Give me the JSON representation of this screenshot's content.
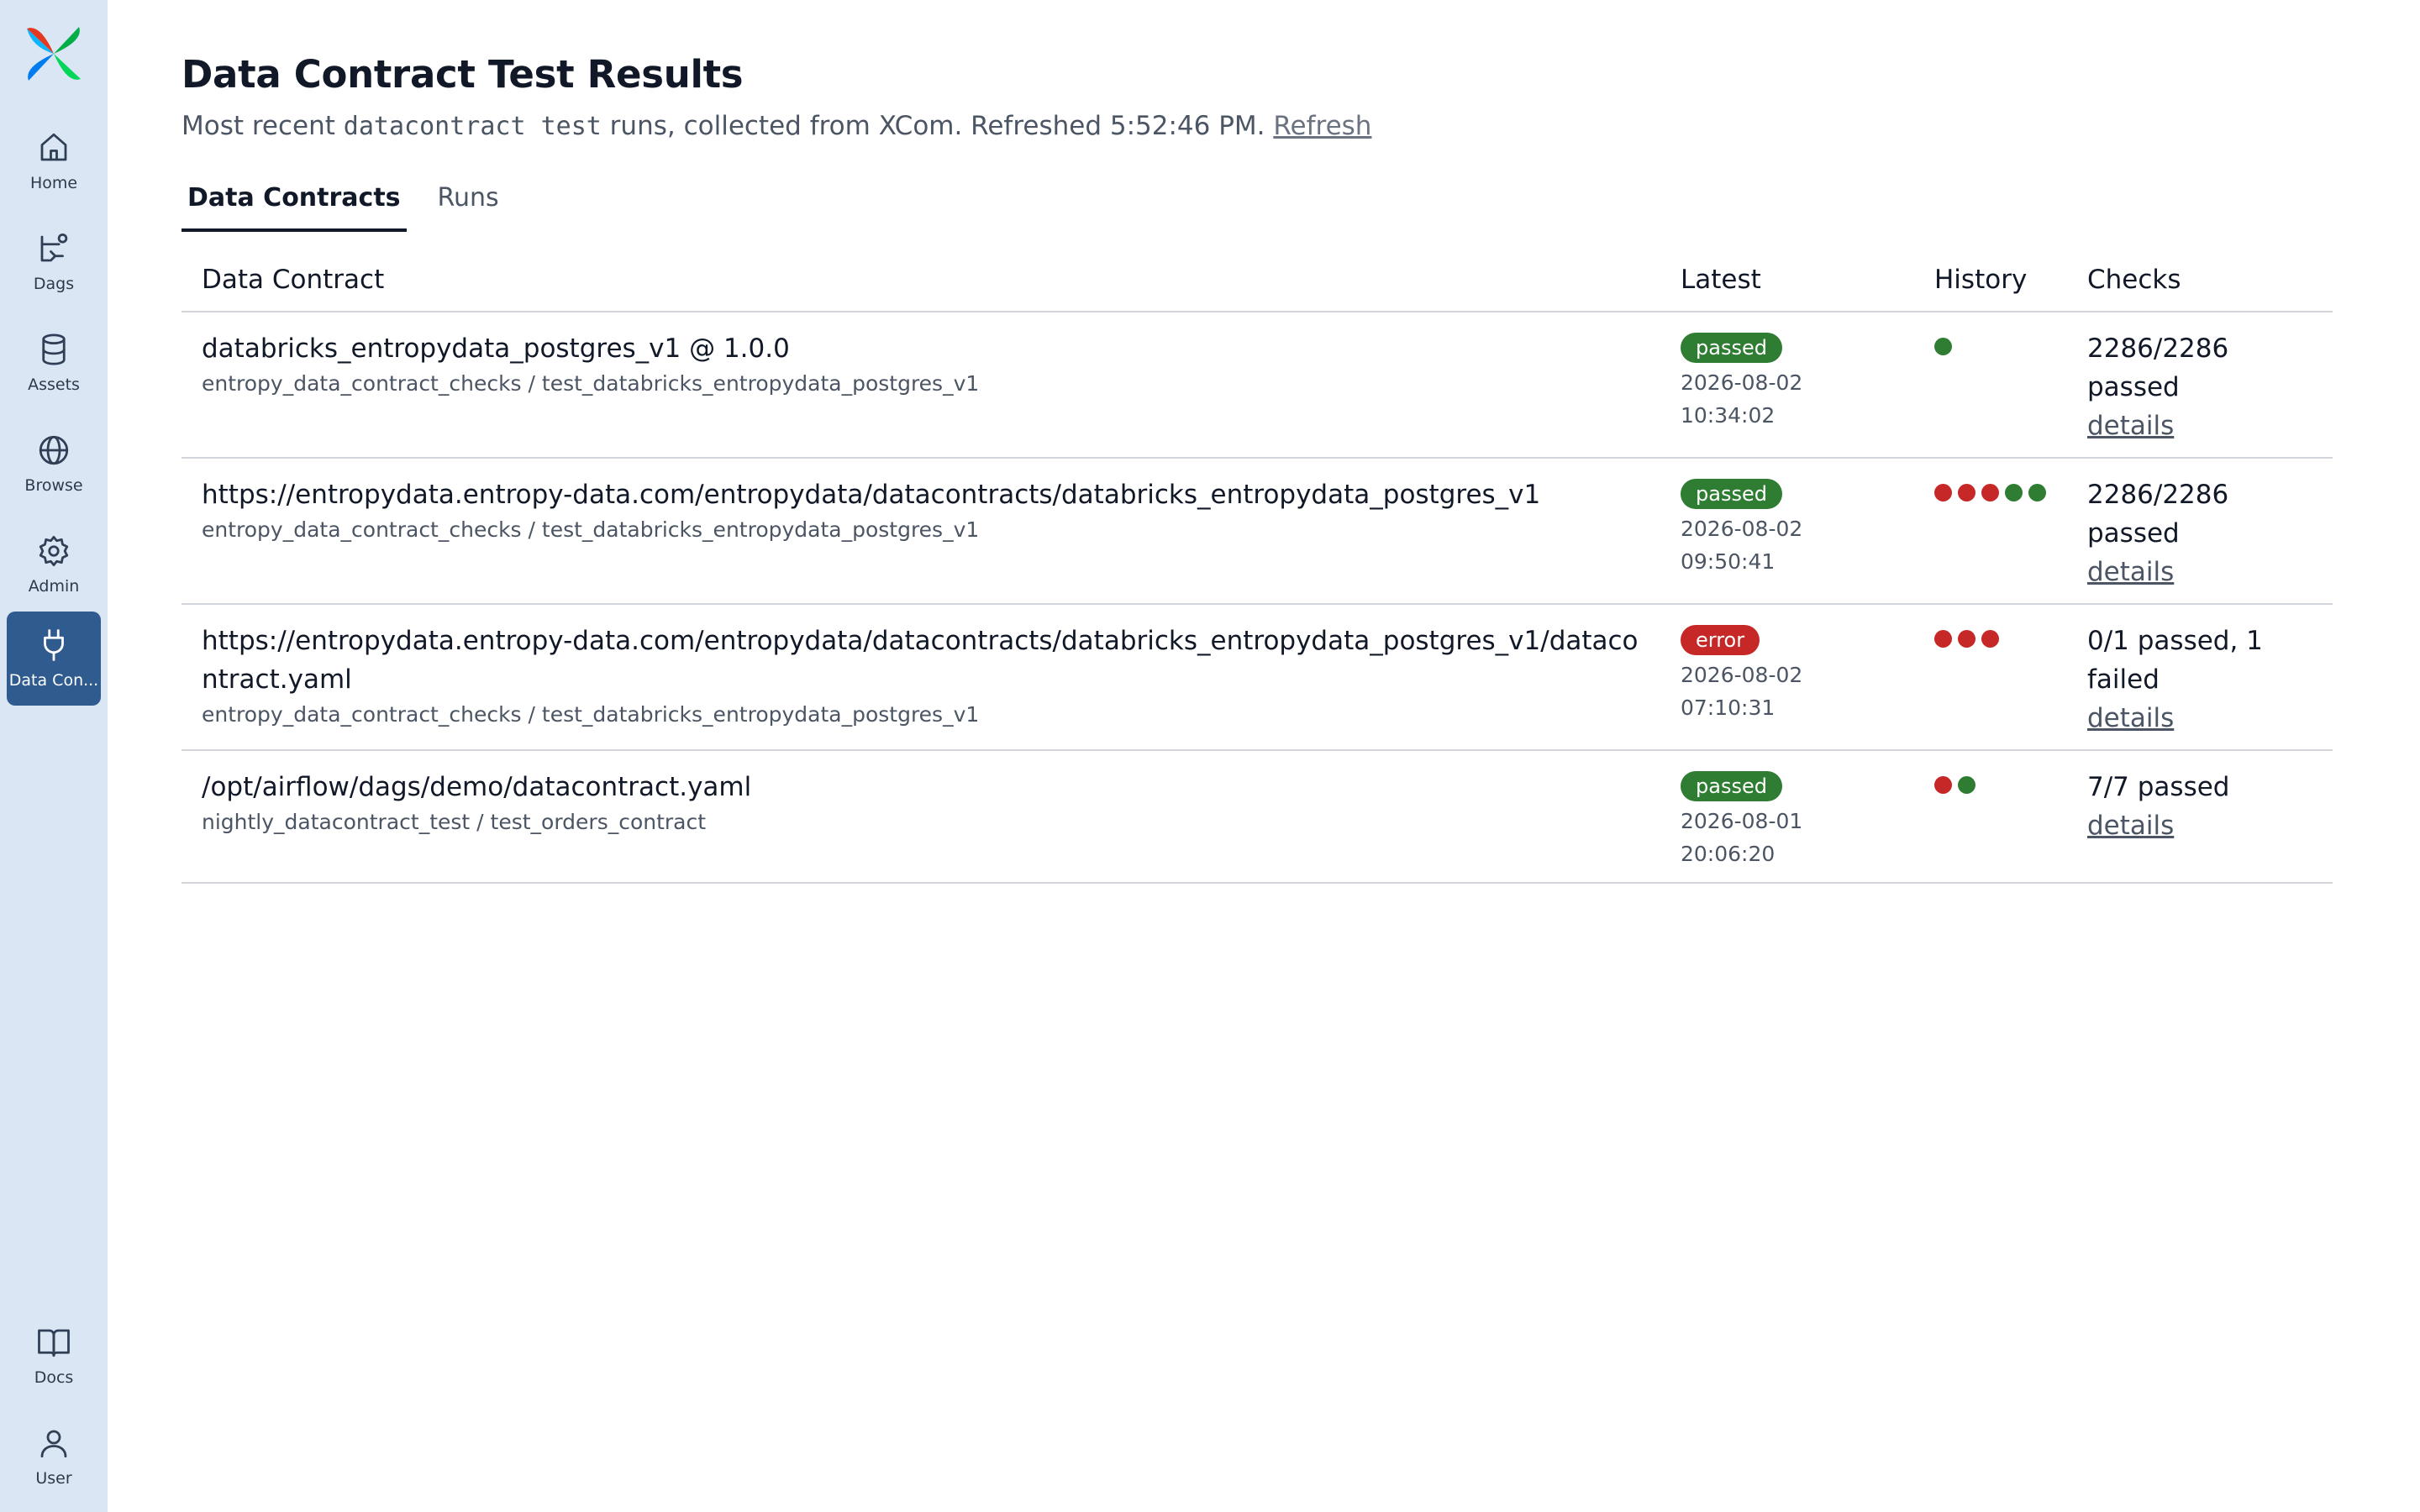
{
  "sidebar": {
    "items": [
      {
        "label": "Home",
        "icon": "home-icon"
      },
      {
        "label": "Dags",
        "icon": "dags-icon"
      },
      {
        "label": "Assets",
        "icon": "database-icon"
      },
      {
        "label": "Browse",
        "icon": "globe-icon"
      },
      {
        "label": "Admin",
        "icon": "gear-icon"
      },
      {
        "label": "Data Con...",
        "icon": "plug-icon",
        "active": true
      }
    ],
    "bottom_items": [
      {
        "label": "Docs",
        "icon": "book-icon"
      },
      {
        "label": "User",
        "icon": "user-icon"
      }
    ]
  },
  "page": {
    "title": "Data Contract Test Results",
    "subtitle_before": "Most recent ",
    "subtitle_code": "datacontract test",
    "subtitle_after": " runs, collected from XCom. Refreshed 5:52:46 PM. ",
    "refresh_label": "Refresh"
  },
  "tabs": [
    {
      "label": "Data Contracts",
      "active": true
    },
    {
      "label": "Runs",
      "active": false
    }
  ],
  "table": {
    "headers": {
      "contract": "Data Contract",
      "latest": "Latest",
      "history": "History",
      "checks": "Checks"
    },
    "rows": [
      {
        "name": "databricks_entropydata_postgres_v1 @ 1.0.0",
        "path": "entropy_data_contract_checks / test_databricks_entropydata_postgres_v1",
        "status": "passed",
        "time": "2026-08-02 10:34:02",
        "history": [
          "passed"
        ],
        "checks": "2286/2286 passed",
        "details": "details"
      },
      {
        "name": "https://entropydata.entropy-data.com/entropydata/datacontracts/databricks_entropydata_postgres_v1",
        "path": "entropy_data_contract_checks / test_databricks_entropydata_postgres_v1",
        "status": "passed",
        "time": "2026-08-02 09:50:41",
        "history": [
          "error",
          "error",
          "error",
          "passed",
          "passed"
        ],
        "checks": "2286/2286 passed",
        "details": "details"
      },
      {
        "name": "https://entropydata.entropy-data.com/entropydata/datacontracts/databricks_entropydata_postgres_v1/datacontract.yaml",
        "path": "entropy_data_contract_checks / test_databricks_entropydata_postgres_v1",
        "status": "error",
        "time": "2026-08-02 07:10:31",
        "history": [
          "error",
          "error",
          "error"
        ],
        "checks": "0/1 passed, 1 failed",
        "details": "details"
      },
      {
        "name": "/opt/airflow/dags/demo/datacontract.yaml",
        "path": "nightly_datacontract_test / test_orders_contract",
        "status": "passed",
        "time": "2026-08-01 20:06:20",
        "history": [
          "error",
          "passed"
        ],
        "checks": "7/7 passed",
        "details": "details"
      }
    ]
  },
  "colors": {
    "sidebar_bg": "#dbe6f4",
    "active_nav": "#2f5b8f",
    "passed": "#2e7d32",
    "error": "#c62828"
  }
}
